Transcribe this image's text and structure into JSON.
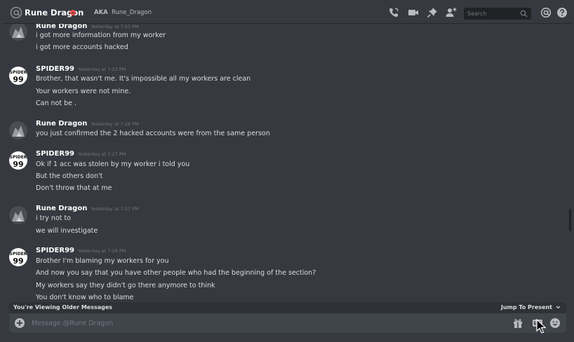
{
  "header": {
    "name": "Rune Dragon",
    "aka_label": "AKA",
    "aka_value": "Rune_Dragon",
    "search_placeholder": "Search",
    "icons": [
      "call-icon",
      "video-icon",
      "pin-icon",
      "add-friend-icon",
      "search-icon",
      "mention-icon",
      "help-icon"
    ]
  },
  "messages": [
    {
      "author": "Rune Dragon",
      "timestamp": "Yesterday at 7:23 PM",
      "lines": [
        "i got more information from my worker",
        "i got more accounts hacked"
      ]
    },
    {
      "author": "SPIDER99",
      "timestamp": "Yesterday at 7:23 PM",
      "lines": [
        "Brother, that wasn't me. It's impossible all my workers are clean",
        "Your workers were not mine.",
        "Can not be ."
      ]
    },
    {
      "author": "Rune Dragon",
      "timestamp": "Yesterday at 7:26 PM",
      "lines": [
        "you just confirmed the 2 hacked accounts were from the same person"
      ]
    },
    {
      "author": "SPIDER99",
      "timestamp": "Yesterday at 7:27 PM",
      "lines": [
        "Ok if 1 acc was stolen by my worker i told you",
        "But the others don't",
        "Don't throw that at me"
      ]
    },
    {
      "author": "Rune Dragon",
      "timestamp": "Yesterday at 7:27 PM",
      "lines": [
        "i try not to",
        "we will investigate"
      ]
    },
    {
      "author": "SPIDER99",
      "timestamp": "Yesterday at 7:28 PM",
      "lines": [
        "Brother I'm blaming my workers for you",
        "And now you say that you have other people who had the beginning of the section?",
        "My workers say they didn't go there anymore to think",
        "You don't know who to blame"
      ]
    }
  ],
  "avatar_text": {
    "spider_top": "SPIDER",
    "spider_bottom": "99"
  },
  "older_bar": {
    "text": "You're Viewing Older Messages",
    "jump": "Jump To Present"
  },
  "composer": {
    "placeholder": "Message @Rune Dragon"
  },
  "colors": {
    "background": "#36393f",
    "composer": "#40444b",
    "dnd": "#f04747",
    "timestamp": "#72767d"
  }
}
